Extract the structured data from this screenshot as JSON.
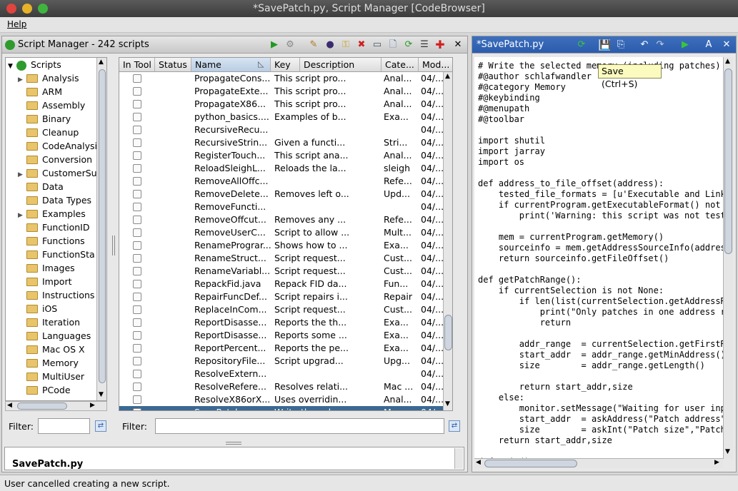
{
  "window": {
    "title": "*SavePatch.py, Script Manager [CodeBrowser]"
  },
  "menu": {
    "help": "Help"
  },
  "script_manager": {
    "title": "Script Manager - 242 scripts",
    "tree_root": "Scripts",
    "categories": [
      "Analysis",
      "ARM",
      "Assembly",
      "Binary",
      "Cleanup",
      "CodeAnalysis",
      "Conversion",
      "CustomerSu",
      "Data",
      "Data Types",
      "Examples",
      "FunctionID",
      "Functions",
      "FunctionSta",
      "Images",
      "Import",
      "Instructions",
      "iOS",
      "Iteration",
      "Languages",
      "Mac OS X",
      "Memory",
      "MultiUser",
      "PCode"
    ],
    "columns": [
      "In Tool",
      "Status",
      "Name",
      "Key",
      "Description",
      "Cate...",
      "Mod..."
    ],
    "rows": [
      [
        "PropagateCons...",
        "",
        "This script pro...",
        "Anal...",
        "04/..."
      ],
      [
        "PropagateExte...",
        "",
        "This script pro...",
        "Anal...",
        "04/..."
      ],
      [
        "PropagateX86...",
        "",
        "This script pro...",
        "Anal...",
        "04/..."
      ],
      [
        "python_basics....",
        "",
        "Examples of b...",
        "Exa...",
        "04/..."
      ],
      [
        "RecursiveRecu...",
        "",
        "",
        "",
        "04/..."
      ],
      [
        "RecursiveStrin...",
        "",
        "Given a functi...",
        "Stri...",
        "04/..."
      ],
      [
        "RegisterTouch...",
        "",
        "This script ana...",
        "Anal...",
        "04/..."
      ],
      [
        "ReloadSleighL...",
        "",
        "Reloads the la...",
        "sleigh",
        "04/..."
      ],
      [
        "RemoveAllOffc...",
        "",
        "",
        "Refe...",
        "04/..."
      ],
      [
        "RemoveDelete...",
        "",
        "Removes left o...",
        "Upd...",
        "04/..."
      ],
      [
        "RemoveFuncti...",
        "",
        "",
        "",
        "04/..."
      ],
      [
        "RemoveOffcut...",
        "",
        "Removes any ...",
        "Refe...",
        "04/..."
      ],
      [
        "RemoveUserC...",
        "",
        "Script to allow ...",
        "Mult...",
        "04/..."
      ],
      [
        "RenamePrograr...",
        "",
        "Shows how to ...",
        "Exa...",
        "04/..."
      ],
      [
        "RenameStruct...",
        "",
        "Script request...",
        "Cust...",
        "04/..."
      ],
      [
        "RenameVariabl...",
        "",
        "Script request...",
        "Cust...",
        "04/..."
      ],
      [
        "RepackFid.java",
        "",
        "Repack FID da...",
        "Fun...",
        "04/..."
      ],
      [
        "RepairFuncDef...",
        "",
        "Script repairs i...",
        "Repair",
        "04/..."
      ],
      [
        "ReplaceInCom...",
        "",
        "Script request...",
        "Cust...",
        "04/..."
      ],
      [
        "ReportDisasse...",
        "",
        "Reports the th...",
        "Exa...",
        "04/..."
      ],
      [
        "ReportDisasse...",
        "",
        "Reports some ...",
        "Exa...",
        "04/..."
      ],
      [
        "ReportPercent...",
        "",
        "Reports the pe...",
        "Exa...",
        "04/..."
      ],
      [
        "RepositoryFile...",
        "",
        "Script upgrad...",
        "Upg...",
        "04/..."
      ],
      [
        "ResolveExtern...",
        "",
        "",
        "",
        "04/..."
      ],
      [
        "ResolveRefere...",
        "",
        "Resolves relati...",
        "Mac ...",
        "04/..."
      ],
      [
        "ResolveX86orX...",
        "",
        "Uses overridin...",
        "Anal...",
        "04/..."
      ],
      [
        "SavePatch.py",
        "",
        "Write the selec...",
        "Me...",
        "04/..."
      ]
    ],
    "selected_row_index": 26,
    "filter_label": "Filter:",
    "filter_value": "",
    "table_filter_label": "Filter:",
    "table_filter_value": "",
    "detail_title": "SavePatch.py"
  },
  "editor": {
    "title": "*SavePatch.py",
    "tooltip": "Save (Ctrl+S)",
    "lines": [
      "# Write the selected memory (including patches) b",
      "#@author schlafwandler",
      "#@category Memory",
      "#@keybinding",
      "#@menupath",
      "#@toolbar",
      "",
      "import shutil",
      "import jarray",
      "import os",
      "",
      "def address_to_file_offset(address):",
      "    tested_file_formats = [u'Executable and Linki",
      "    if currentProgram.getExecutableFormat() not i",
      "        print('Warning: this script was not teste",
      "",
      "    mem = currentProgram.getMemory()",
      "    sourceinfo = mem.getAddressSourceInfo(address",
      "    return sourceinfo.getFileOffset()",
      "",
      "def getPatchRange():",
      "    if currentSelection is not None:",
      "        if len(list(currentSelection.getAddressRa",
      "            print(\"Only patches in one address ra",
      "            return",
      "",
      "        addr_range  = currentSelection.getFirstRa",
      "        start_addr  = addr_range.getMinAddress()",
      "        size        = addr_range.getLength()",
      "",
      "        return start_addr,size",
      "    else:",
      "        monitor.setMessage(\"Waiting for user inpu",
      "        start_addr  = askAddress(\"Patch address\",",
      "        size        = askInt(\"Patch size\",\"Patch",
      "    return start_addr,size",
      "",
      "def main():"
    ]
  },
  "status_bar": {
    "message": "User cancelled creating a new script."
  }
}
